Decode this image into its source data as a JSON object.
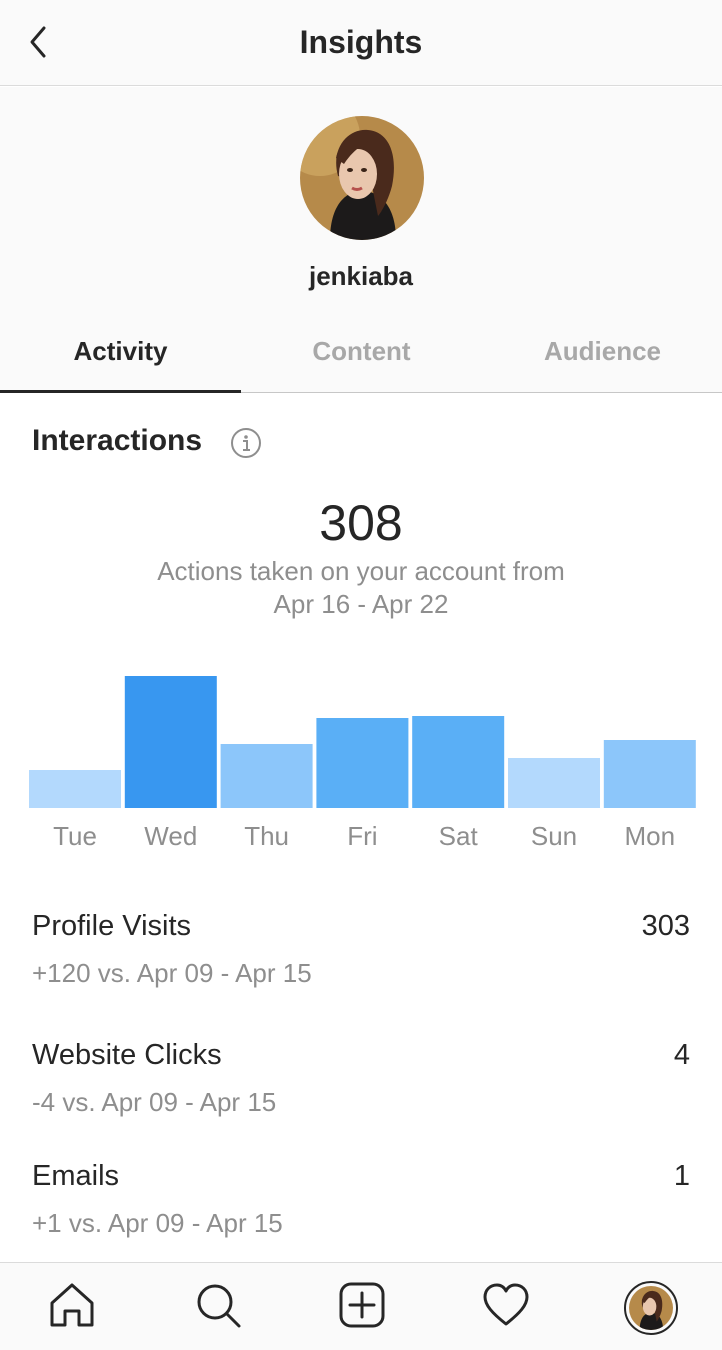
{
  "header": {
    "title": "Insights",
    "back_icon": "chevron-left-icon"
  },
  "profile": {
    "username": "jenkiaba",
    "avatar": "profile-photo"
  },
  "tabs": [
    {
      "label": "Activity",
      "active": true
    },
    {
      "label": "Content",
      "active": false
    },
    {
      "label": "Audience",
      "active": false
    }
  ],
  "interactions": {
    "title": "Interactions",
    "info_icon": "info-icon",
    "total": "308",
    "subtitle_line1": "Actions taken on your account from",
    "subtitle_line2": "Apr 16 - Apr 22"
  },
  "chart_data": {
    "type": "bar",
    "categories": [
      "Tue",
      "Wed",
      "Thu",
      "Fri",
      "Sat",
      "Sun",
      "Mon"
    ],
    "values": [
      19,
      66,
      32,
      45,
      46,
      25,
      34
    ],
    "colors": [
      "#b3d9fd",
      "#3897f0",
      "#8cc6fa",
      "#5aaff6",
      "#5aaff6",
      "#b3d9fd",
      "#8cc6fa"
    ],
    "title": "",
    "xlabel": "",
    "ylabel": "",
    "ylim": [
      0,
      66
    ],
    "grid": false
  },
  "metrics": [
    {
      "label": "Profile Visits",
      "value": "303",
      "comparison": "+120 vs. Apr 09 - Apr 15"
    },
    {
      "label": "Website Clicks",
      "value": "4",
      "comparison": "-4 vs. Apr 09 - Apr 15"
    },
    {
      "label": "Emails",
      "value": "1",
      "comparison": "+1 vs. Apr 09 - Apr 15"
    }
  ],
  "tabbar": {
    "icons": [
      "home-icon",
      "search-icon",
      "add-post-icon",
      "heart-icon",
      "profile-avatar"
    ]
  },
  "colors": {
    "text": "#262626",
    "secondary": "#8e8e8e",
    "accent": "#3897f0",
    "header_bg": "#fafafa"
  }
}
